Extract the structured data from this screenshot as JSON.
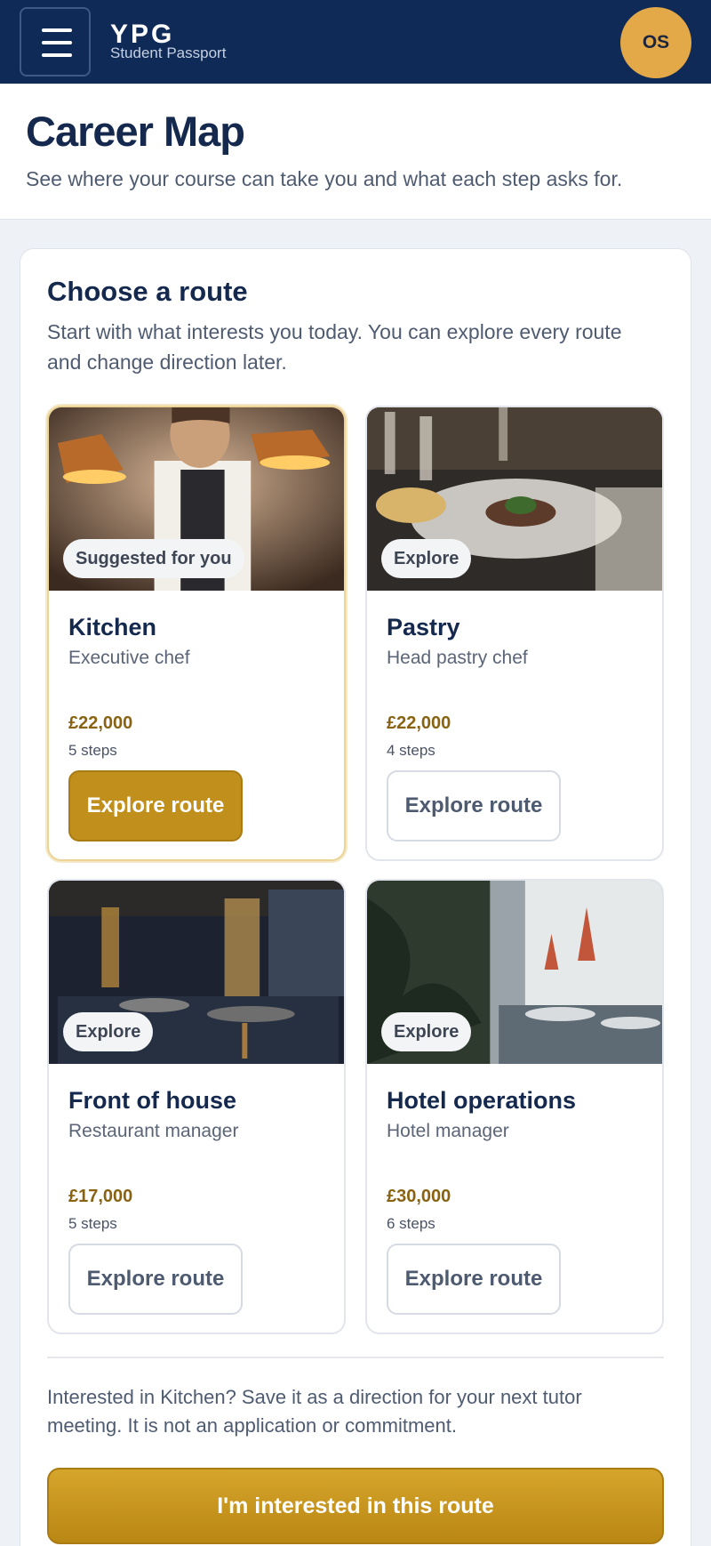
{
  "topbar": {
    "brand": "YPG",
    "brand_sub": "Student Passport",
    "avatar_initials": "OS"
  },
  "header": {
    "title": "Career Map",
    "subtitle": "See where your course can take you and what each step asks for."
  },
  "routes_section": {
    "title": "Choose a route",
    "description": "Start with what interests you today. You can explore every route and change direction later.",
    "routes": [
      {
        "badge": "Suggested for you",
        "title": "Kitchen",
        "role": "Executive chef",
        "salary": "£22,000",
        "steps": "5 steps",
        "button": "Explore route",
        "selected": true
      },
      {
        "badge": "Explore",
        "title": "Pastry",
        "role": "Head pastry chef",
        "salary": "£22,000",
        "steps": "4 steps",
        "button": "Explore route",
        "selected": false
      },
      {
        "badge": "Explore",
        "title": "Front of house",
        "role": "Restaurant manager",
        "salary": "£17,000",
        "steps": "5 steps",
        "button": "Explore route",
        "selected": false
      },
      {
        "badge": "Explore",
        "title": "Hotel operations",
        "role": "Hotel manager",
        "salary": "£30,000",
        "steps": "6 steps",
        "button": "Explore route",
        "selected": false
      }
    ]
  },
  "footer": {
    "note": "Interested in Kitchen? Save it as a direction for your next tutor meeting. It is not an application or commitment.",
    "button": "I'm interested in this route"
  },
  "colors": {
    "navy": "#0f2a56",
    "gold": "#c18f1b",
    "avatar": "#e3a948"
  }
}
